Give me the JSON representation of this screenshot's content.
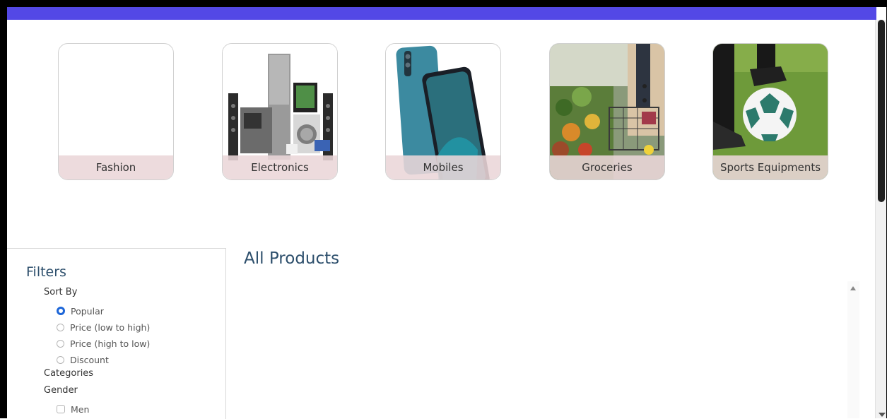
{
  "categories": [
    {
      "label": "Fashion",
      "icon": "blank-image"
    },
    {
      "label": "Electronics",
      "icon": "appliances-image"
    },
    {
      "label": "Mobiles",
      "icon": "phones-image"
    },
    {
      "label": "Groceries",
      "icon": "groceries-image"
    },
    {
      "label": "Sports Equipments",
      "icon": "football-image"
    }
  ],
  "filters": {
    "title": "Filters",
    "sort_title": "Sort By",
    "sort_options": [
      {
        "label": "Popular",
        "selected": true
      },
      {
        "label": "Price (low to high)",
        "selected": false
      },
      {
        "label": "Price (high to low)",
        "selected": false
      },
      {
        "label": "Discount",
        "selected": false
      }
    ],
    "categories_title": "Categories",
    "gender_title": "Gender",
    "gender_options": [
      {
        "label": "Men",
        "checked": false
      }
    ]
  },
  "products": {
    "title": "All Products"
  },
  "colors": {
    "top_bar": "#5348e6",
    "heading": "#2d4f6c",
    "radio_selected": "#1d66d8",
    "label_overlay": "#ebd6d8"
  }
}
